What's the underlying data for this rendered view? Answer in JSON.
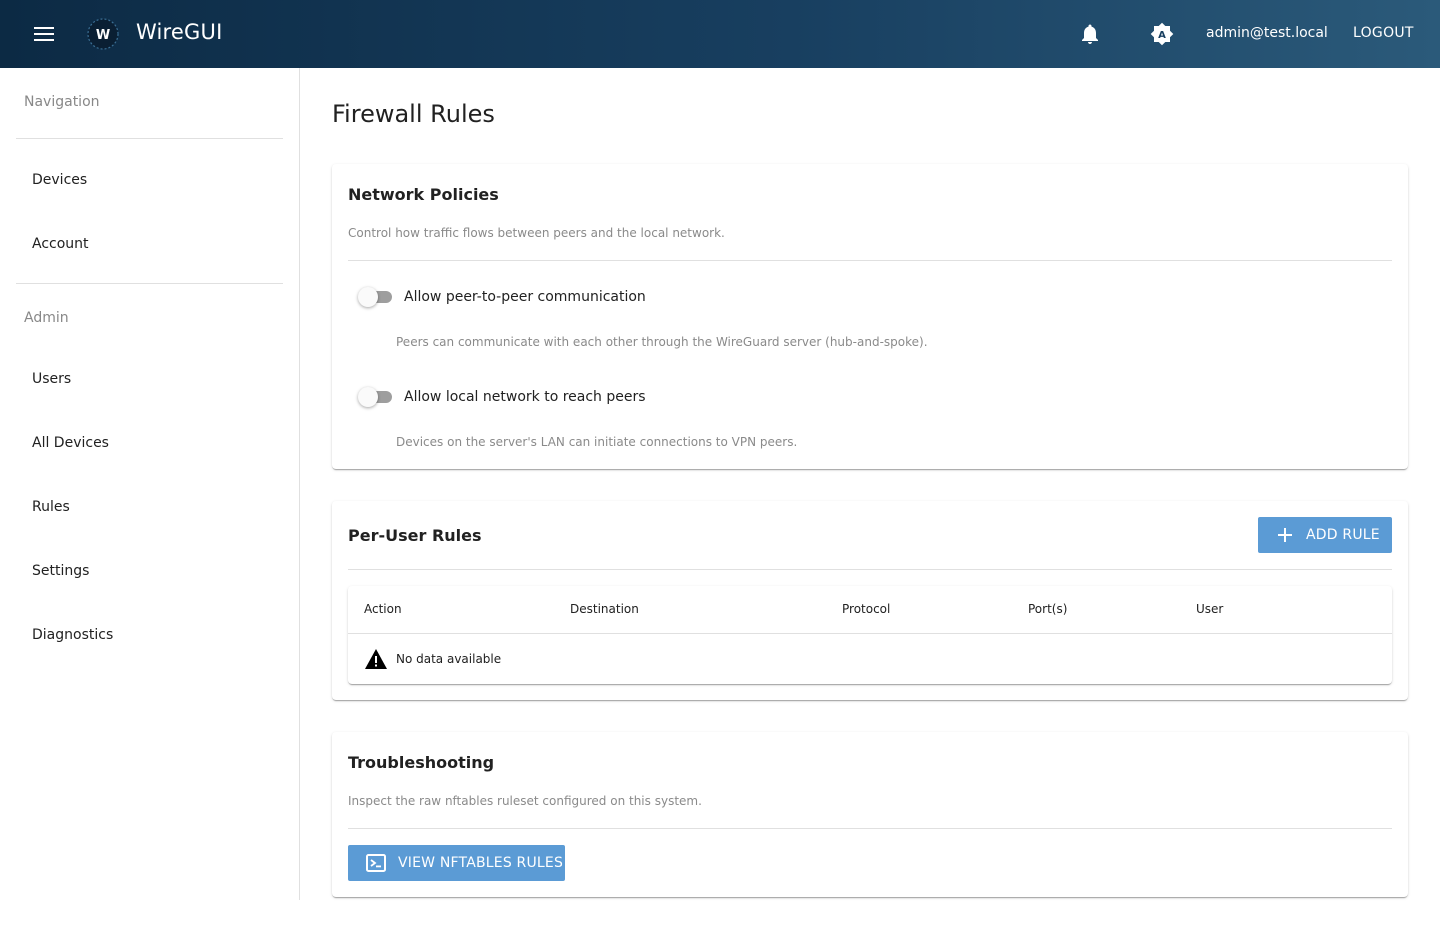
{
  "app": {
    "title": "WireGUI",
    "logo_letter": "W"
  },
  "header": {
    "user_email": "admin@test.local",
    "logout_label": "LOGOUT"
  },
  "sidebar": {
    "navigation_header": "Navigation",
    "navigation_items": [
      {
        "label": "Devices"
      },
      {
        "label": "Account"
      }
    ],
    "admin_header": "Admin",
    "admin_items": [
      {
        "label": "Users"
      },
      {
        "label": "All Devices"
      },
      {
        "label": "Rules"
      },
      {
        "label": "Settings"
      },
      {
        "label": "Diagnostics"
      }
    ]
  },
  "page": {
    "title": "Firewall Rules"
  },
  "network_policies": {
    "title": "Network Policies",
    "subtitle": "Control how traffic flows between peers and the local network.",
    "switches": [
      {
        "label": "Allow peer-to-peer communication",
        "hint": "Peers can communicate with each other through the WireGuard server (hub-and-spoke).",
        "enabled": false
      },
      {
        "label": "Allow local network to reach peers",
        "hint": "Devices on the server's LAN can initiate connections to VPN peers.",
        "enabled": false
      }
    ]
  },
  "per_user_rules": {
    "title": "Per-User Rules",
    "add_button_label": "ADD RULE",
    "columns": [
      "Action",
      "Destination",
      "Protocol",
      "Port(s)",
      "User"
    ],
    "rows": [],
    "empty_text": "No data available"
  },
  "troubleshooting": {
    "title": "Troubleshooting",
    "subtitle": "Inspect the raw nftables ruleset configured on this system.",
    "button_label": "VIEW NFTABLES RULES"
  },
  "colors": {
    "appbar_start": "#0c2a44",
    "appbar_end": "#2b5a7a",
    "primary_button": "#5b9bd5",
    "switch_off_track": "#9e9e9e"
  },
  "icons": {
    "menu": "menu-icon",
    "logo": "wiregui-logo-icon",
    "notifications": "bell-icon",
    "theme": "brightness-auto-icon",
    "add": "plus-icon",
    "warning": "warning-icon",
    "terminal": "console-icon"
  }
}
